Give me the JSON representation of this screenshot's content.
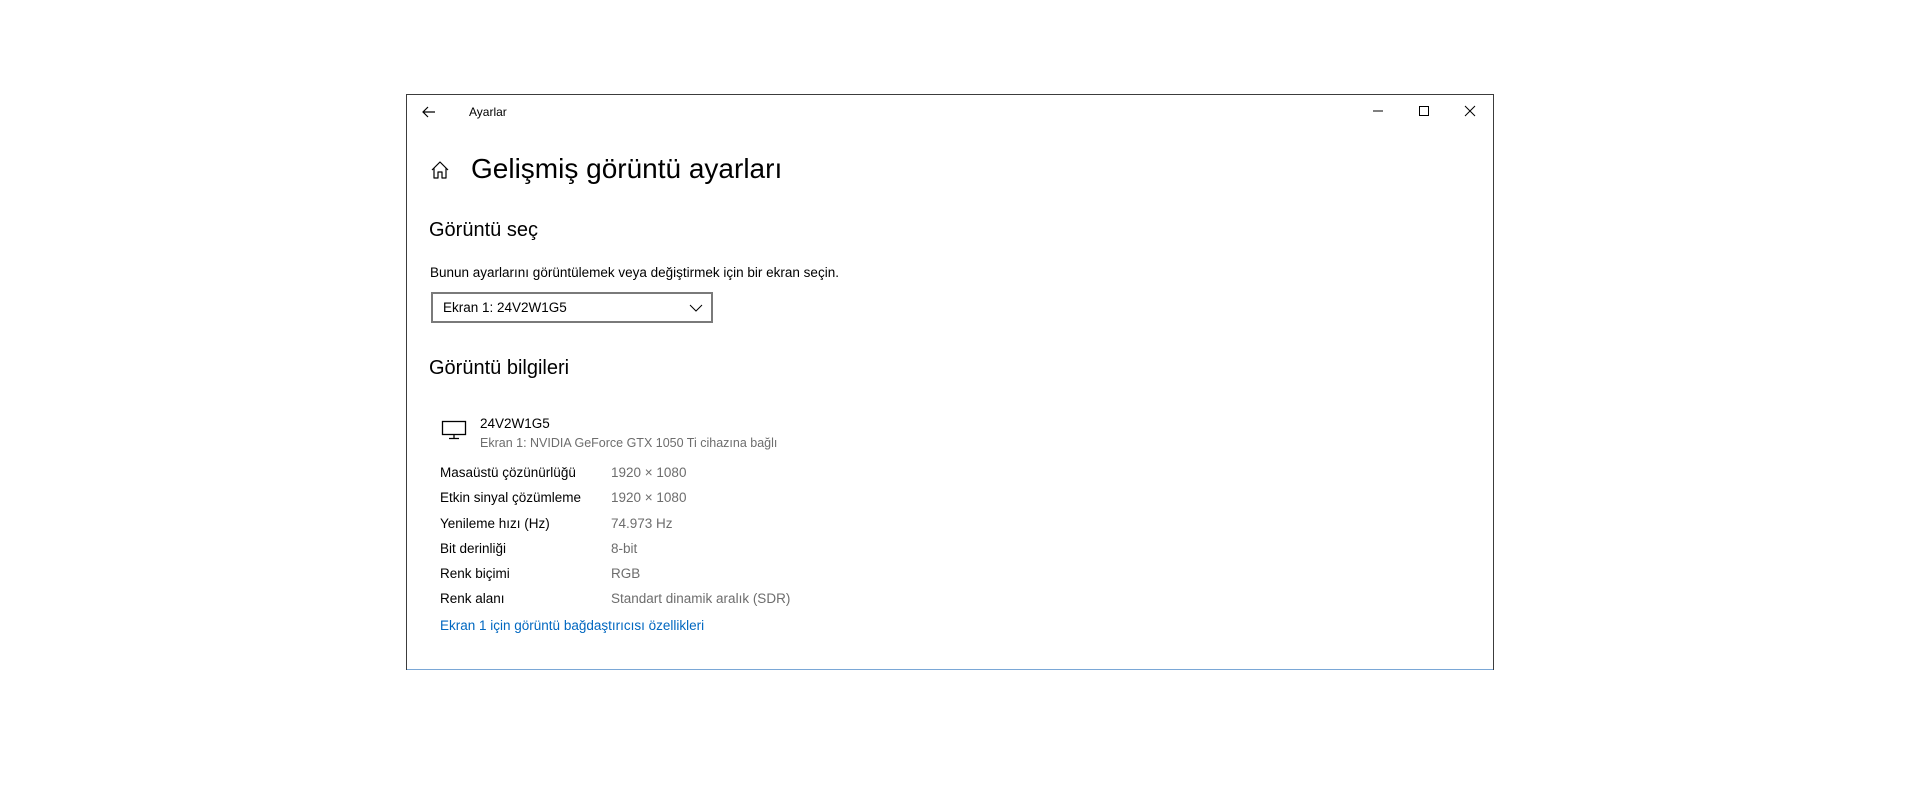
{
  "titlebar": {
    "app_title": "Ayarlar",
    "icons": {
      "back": "back-arrow-icon",
      "minimize": "minimize-icon",
      "maximize": "maximize-icon",
      "close": "close-icon"
    }
  },
  "page": {
    "title": "Gelişmiş görüntü ayarları",
    "home_icon": "home-icon"
  },
  "select_display": {
    "heading": "Görüntü seç",
    "description": "Bunun ayarlarını görüntülemek veya değiştirmek için bir ekran seçin.",
    "selected_value": "Ekran 1: 24V2W1G5"
  },
  "display_info": {
    "heading": "Görüntü bilgileri",
    "monitor_name": "24V2W1G5",
    "monitor_subtitle": "Ekran 1: NVIDIA GeForce GTX 1050 Ti cihazına bağlı",
    "rows": [
      {
        "label": "Masaüstü çözünürlüğü",
        "value": "1920 × 1080"
      },
      {
        "label": "Etkin sinyal çözümleme",
        "value": "1920 × 1080"
      },
      {
        "label": "Yenileme hızı (Hz)",
        "value": "74.973 Hz"
      },
      {
        "label": "Bit derinliği",
        "value": "8-bit"
      },
      {
        "label": "Renk biçimi",
        "value": "RGB"
      },
      {
        "label": "Renk alanı",
        "value": "Standart dinamik aralık (SDR)"
      }
    ],
    "adapter_link": "Ekran 1 için görüntü bağdaştırıcısı özellikleri"
  },
  "colors": {
    "link": "#0067c0",
    "secondary_text": "#6d6d6d",
    "window_border": "#3c3c3c"
  }
}
